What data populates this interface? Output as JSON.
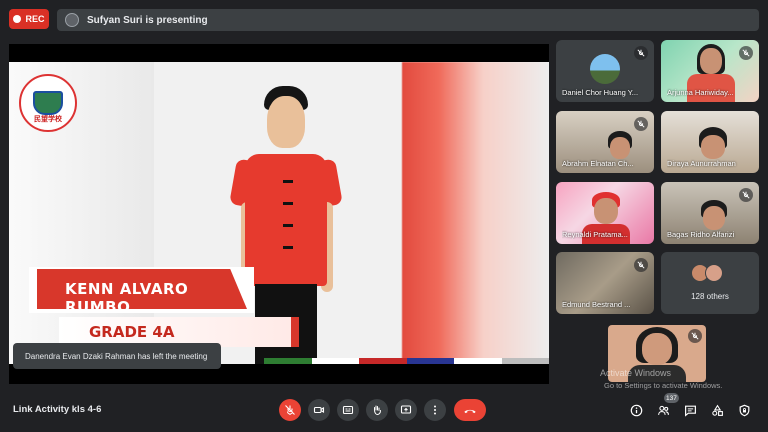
{
  "top_bar": {
    "rec_label": "REC",
    "presenter_text": "Sufyan Suri is presenting"
  },
  "slide": {
    "school_logo_text": "民望学校",
    "student_name": "KENN ALVARO RUMBO",
    "student_grade": "GRADE 4A",
    "stripe_colors": [
      "#2e7d32",
      "#ffffff",
      "#c62828",
      "#283593",
      "#ffffff",
      "#bdbdbd"
    ]
  },
  "toast": "Danendra Evan Dzaki Rahman has left the meeting",
  "participants": [
    {
      "name": "Daniel Chor Huang Y...",
      "muted": true
    },
    {
      "name": "Arjunna Hariwiday...",
      "muted": true
    },
    {
      "name": "Abrahm Elnatan Ch...",
      "muted": true
    },
    {
      "name": "Diraya Aunurrahman",
      "muted": false
    },
    {
      "name": "Reynaldi Pratama...",
      "muted": false
    },
    {
      "name": "Bagas Ridho Alfarizi",
      "muted": true
    },
    {
      "name": "Edmund Bestrand ...",
      "muted": true
    }
  ],
  "others": {
    "label": "128 others"
  },
  "watermark": {
    "line1": "Activate Windows",
    "line2": "Go to Settings to activate Windows."
  },
  "bottom_bar": {
    "meeting_title": "Link Activity kls 4-6",
    "people_count": "137"
  },
  "colors": {
    "background": "#202124",
    "surface": "#3c4043",
    "danger": "#ea4335",
    "accent_red": "#d8372b"
  }
}
